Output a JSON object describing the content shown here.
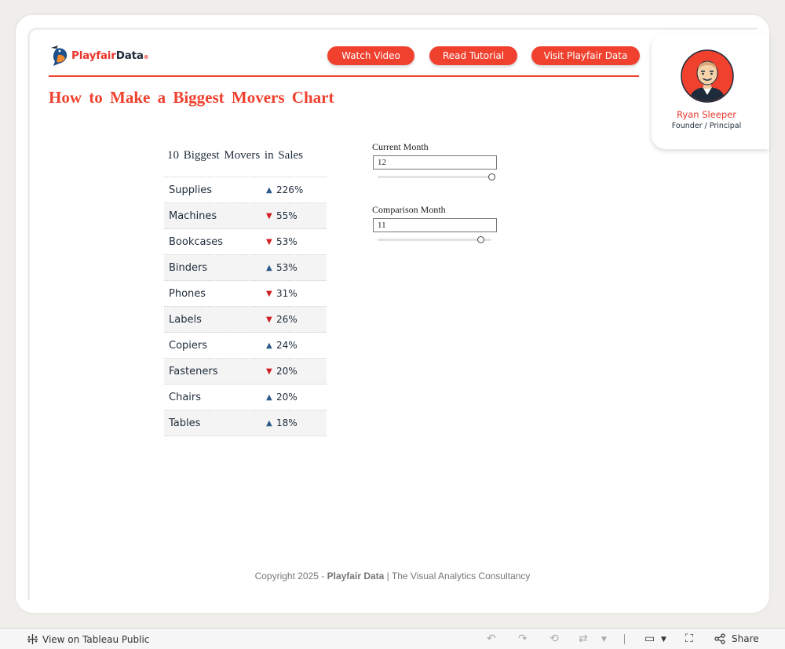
{
  "header": {
    "logo": {
      "part1": "Playfair",
      "part2": "Data",
      "reg": "®"
    },
    "buttons": [
      {
        "label": "Watch Video"
      },
      {
        "label": "Read Tutorial"
      },
      {
        "label": "Visit Playfair Data"
      }
    ],
    "title": "How to Make a Biggest Movers Chart"
  },
  "profile": {
    "name": "Ryan Sleeper",
    "role": "Founder / Principal"
  },
  "table": {
    "title": "10 Biggest Movers in Sales",
    "rows": [
      {
        "category": "Supplies",
        "direction": "up",
        "change": "226%"
      },
      {
        "category": "Machines",
        "direction": "down",
        "change": "55%"
      },
      {
        "category": "Bookcases",
        "direction": "down",
        "change": "53%"
      },
      {
        "category": "Binders",
        "direction": "up",
        "change": "53%"
      },
      {
        "category": "Phones",
        "direction": "down",
        "change": "31%"
      },
      {
        "category": "Labels",
        "direction": "down",
        "change": "26%"
      },
      {
        "category": "Copiers",
        "direction": "up",
        "change": "24%"
      },
      {
        "category": "Fasteners",
        "direction": "down",
        "change": "20%"
      },
      {
        "category": "Chairs",
        "direction": "up",
        "change": "20%"
      },
      {
        "category": "Tables",
        "direction": "up",
        "change": "18%"
      }
    ],
    "arrow_glyphs": {
      "up": "▲",
      "down": "▼"
    },
    "colors": {
      "up": "#2e5a88",
      "down": "#cf1e24"
    }
  },
  "filters": {
    "current_month": {
      "label": "Current Month",
      "value": "12",
      "slider_fraction": 1.0
    },
    "comparison_month": {
      "label": "Comparison Month",
      "value": "11",
      "slider_fraction": 0.909
    }
  },
  "footer": {
    "copyright_prefix": "Copyright 2025 - ",
    "copyright_brand": "Playfair Data",
    "copyright_suffix": " | The Visual Analytics Consultancy"
  },
  "toolbar": {
    "view_label": "View on Tableau Public",
    "share_label": "Share",
    "icons": [
      "tableau-icon",
      "undo-icon",
      "redo-icon",
      "revert-icon",
      "refresh-icon",
      "device-preview-icon",
      "fullscreen-icon",
      "share-icon"
    ]
  },
  "colors": {
    "accent": "#f0412f",
    "navy": "#1d2b3a",
    "background": "#efeeea"
  }
}
